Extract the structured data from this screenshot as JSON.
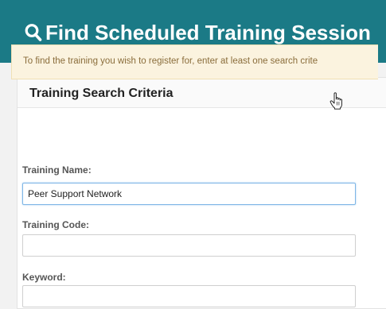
{
  "header": {
    "title": "Find Scheduled Training Session"
  },
  "panel": {
    "title": "Training Search Criteria",
    "info_text": "To find the training you wish to register for, enter at least one search crite"
  },
  "fields": {
    "training_name": {
      "label": "Training Name:",
      "value": "Peer Support Network"
    },
    "training_code": {
      "label": "Training Code:",
      "value": ""
    },
    "keyword": {
      "label": "Keyword:",
      "value": ""
    }
  },
  "colors": {
    "header_bg": "#1b7a86",
    "info_bg": "#fbf3df",
    "info_text": "#8a6d3b"
  },
  "icons": {
    "header_icon": "search-icon",
    "cursor": "hand-pointer-cursor-icon"
  }
}
